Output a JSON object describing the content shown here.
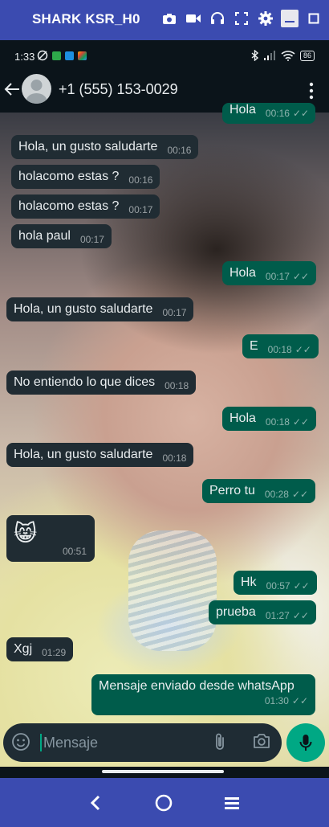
{
  "emulator": {
    "title": "SHARK KSR_H0",
    "icons": [
      "camera-icon",
      "video-icon",
      "headset-icon",
      "fullscreen-icon",
      "gear-icon",
      "minimize-icon",
      "maximize-icon"
    ],
    "bar_color": "#3b4bb0"
  },
  "status_bar": {
    "time": "1:33",
    "battery": "86"
  },
  "header": {
    "contact": "+1 (555) 153-0029"
  },
  "messages": [
    {
      "dir": "out",
      "text": "Hola",
      "time": "00:16",
      "ticks": "✓✓"
    },
    {
      "dir": "in",
      "text": "Hola, un gusto saludarte",
      "time": "00:16"
    },
    {
      "dir": "in",
      "text": "holacomo estas ?",
      "time": "00:16"
    },
    {
      "dir": "in",
      "text": "holacomo estas ?",
      "time": "00:17"
    },
    {
      "dir": "in",
      "text": "hola paul",
      "time": "00:17"
    },
    {
      "dir": "out",
      "text": "Hola",
      "time": "00:17",
      "ticks": "✓✓"
    },
    {
      "dir": "in",
      "text": "Hola, un gusto saludarte",
      "time": "00:17"
    },
    {
      "dir": "out",
      "text": "E",
      "time": "00:18",
      "ticks": "✓✓"
    },
    {
      "dir": "in",
      "text": "No entiendo lo que dices",
      "time": "00:18"
    },
    {
      "dir": "out",
      "text": "Hola",
      "time": "00:18",
      "ticks": "✓✓"
    },
    {
      "dir": "in",
      "text": "Hola, un gusto saludarte",
      "time": "00:18"
    },
    {
      "dir": "out",
      "text": "Perro tu",
      "time": "00:28",
      "ticks": "✓✓"
    },
    {
      "dir": "in",
      "text": "😸",
      "time": "00:51"
    },
    {
      "dir": "out",
      "text": "Hk",
      "time": "00:57",
      "ticks": "✓✓"
    },
    {
      "dir": "out",
      "text": "prueba",
      "time": "01:27",
      "ticks": "✓✓"
    },
    {
      "dir": "in",
      "text": "Xgj",
      "time": "01:29"
    },
    {
      "dir": "out",
      "text": "Mensaje enviado desde whatsApp",
      "time": "01:30",
      "ticks": "✓✓"
    }
  ],
  "input": {
    "placeholder": "Mensaje",
    "value": ""
  },
  "nav": {
    "buttons": [
      "back-icon",
      "home-icon",
      "menu-icon"
    ]
  },
  "colors": {
    "incoming_bubble": "#202c33",
    "outgoing_bubble": "#005c4b",
    "accent": "#00a884"
  }
}
